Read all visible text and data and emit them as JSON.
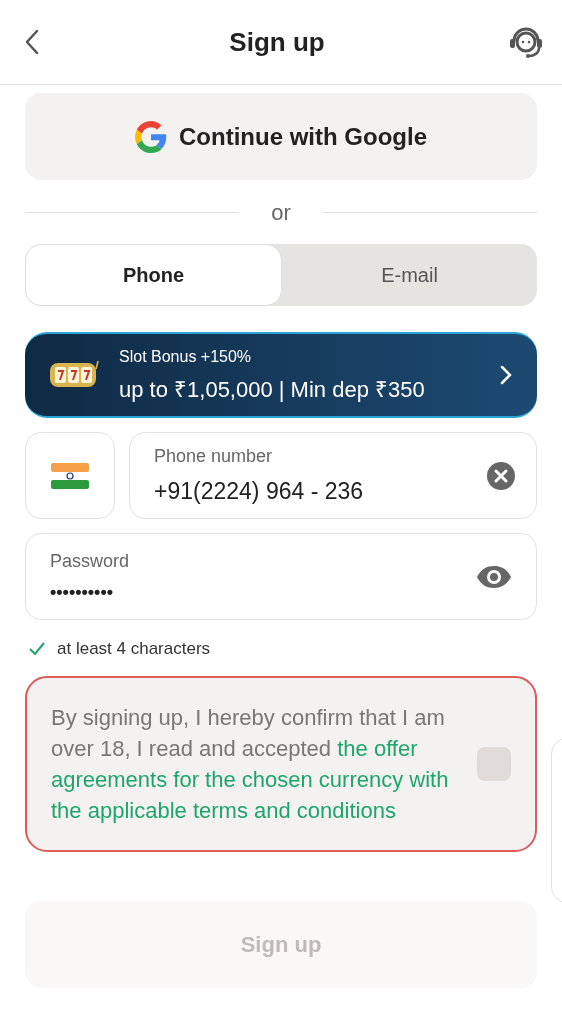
{
  "header": {
    "title": "Sign up"
  },
  "google_button": {
    "label": "Continue with Google"
  },
  "divider": {
    "label": "or"
  },
  "tabs": [
    {
      "label": "Phone",
      "selected": true
    },
    {
      "label": "E-mail",
      "selected": false
    }
  ],
  "banner": {
    "title": "Slot Bonus +150%",
    "subtitle": "up to ₹1,05,000 | Min dep ₹350"
  },
  "phone_field": {
    "label": "Phone number",
    "value": "+91(2224) 964 - 236"
  },
  "password_field": {
    "label": "Password",
    "value": "••••••••••"
  },
  "password_hint": {
    "text": "at least 4 characters",
    "met": true
  },
  "agreement": {
    "text": "By signing up, I hereby confirm that I am over 18, I read and accepted ",
    "link_text": "the offer agreements for the chosen currency with the applicable terms and conditions",
    "checked": false,
    "error": true
  },
  "submit_button": {
    "label": "Sign up",
    "disabled": true
  }
}
